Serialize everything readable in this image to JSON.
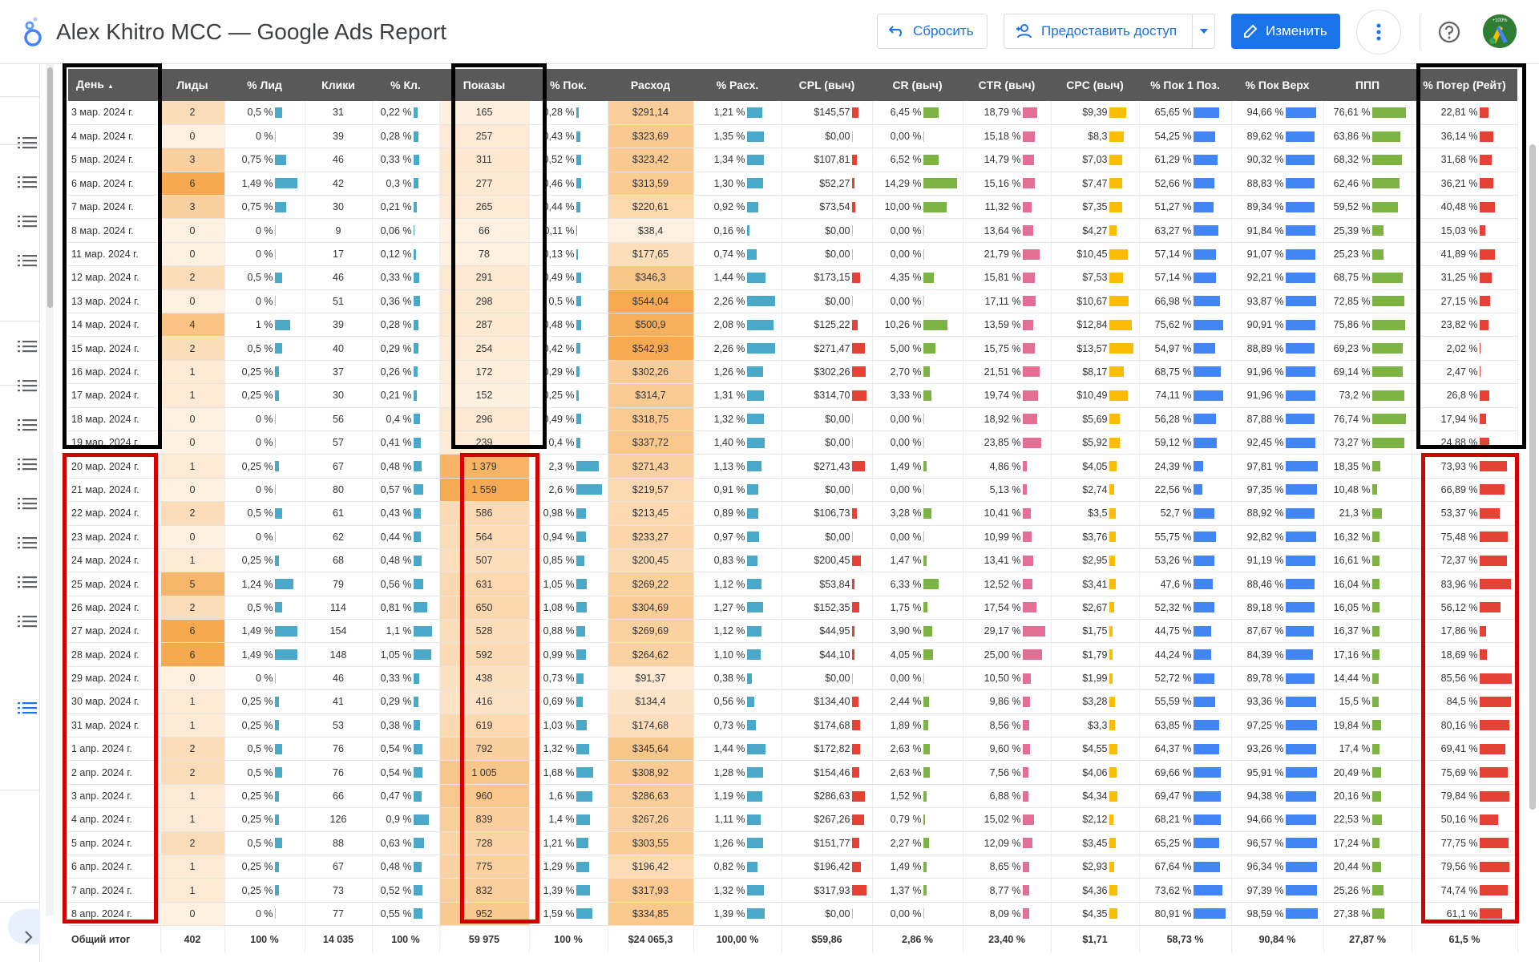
{
  "header": {
    "title": "Alex Khitro MCC — Google Ads Report",
    "reset_label": "Сбросить",
    "share_label": "Предоставить доступ",
    "edit_label": "Изменить",
    "avatar_badge": "+100%"
  },
  "colors": {
    "accent": "#1a73e8",
    "header_bg": "#595959",
    "heat_orange": "#f6a94f",
    "bar_blue": "#4aa8c8",
    "bar_red": "#e34234",
    "bar_green": "#7cb342",
    "bar_pink": "#e36f95",
    "bar_yellow": "#fbbc04",
    "bar_lightblue": "#4285f4",
    "box_black": "#000000",
    "box_red": "#d40000"
  },
  "columns": [
    "День",
    "Лиды",
    "% Лид",
    "Клики",
    "% Кл.",
    "Показы",
    "% Пок.",
    "Расход",
    "% Расх.",
    "CPL (выч)",
    "CR (выч)",
    "CTR (выч)",
    "CPC (выч)",
    "% Пок 1 Поз.",
    "% Пок Верх",
    "ППП",
    "% Потер (Рейт)"
  ],
  "sort_indicator": "▲",
  "rows": [
    [
      "3 мар. 2024 г.",
      "2",
      "0,5 %",
      "31",
      "0,22 %",
      "165",
      "0,28 %",
      "$291,14",
      "1,21 %",
      "$145,57",
      "6,45 %",
      "18,79 %",
      "$9,39",
      "65,65 %",
      "94,66 %",
      "76,61 %",
      "22,81 %"
    ],
    [
      "4 мар. 2024 г.",
      "0",
      "0 %",
      "39",
      "0,28 %",
      "257",
      "0,43 %",
      "$323,69",
      "1,35 %",
      "$0,00",
      "0,00 %",
      "15,18 %",
      "$8,3",
      "54,25 %",
      "89,62 %",
      "63,86 %",
      "36,14 %"
    ],
    [
      "5 мар. 2024 г.",
      "3",
      "0,75 %",
      "46",
      "0,33 %",
      "311",
      "0,52 %",
      "$323,42",
      "1,34 %",
      "$107,81",
      "6,52 %",
      "14,79 %",
      "$7,03",
      "61,29 %",
      "90,32 %",
      "68,32 %",
      "31,68 %"
    ],
    [
      "6 мар. 2024 г.",
      "6",
      "1,49 %",
      "42",
      "0,3 %",
      "277",
      "0,46 %",
      "$313,59",
      "1,30 %",
      "$52,27",
      "14,29 %",
      "15,16 %",
      "$7,47",
      "52,66 %",
      "88,83 %",
      "62,46 %",
      "36,21 %"
    ],
    [
      "7 мар. 2024 г.",
      "3",
      "0,75 %",
      "30",
      "0,21 %",
      "265",
      "0,44 %",
      "$220,61",
      "0,92 %",
      "$73,54",
      "10,00 %",
      "11,32 %",
      "$7,35",
      "51,27 %",
      "89,34 %",
      "59,52 %",
      "40,48 %"
    ],
    [
      "8 мар. 2024 г.",
      "0",
      "0 %",
      "9",
      "0,06 %",
      "66",
      "0,11 %",
      "$38,4",
      "0,16 %",
      "$0,00",
      "0,00 %",
      "13,64 %",
      "$4,27",
      "63,27 %",
      "91,84 %",
      "25,39 %",
      "15,03 %"
    ],
    [
      "11 мар. 2024 г.",
      "0",
      "0 %",
      "17",
      "0,12 %",
      "78",
      "0,13 %",
      "$177,65",
      "0,74 %",
      "$0,00",
      "0,00 %",
      "21,79 %",
      "$10,45",
      "57,14 %",
      "91,07 %",
      "25,23 %",
      "41,89 %"
    ],
    [
      "12 мар. 2024 г.",
      "2",
      "0,5 %",
      "46",
      "0,33 %",
      "291",
      "0,49 %",
      "$346,3",
      "1,44 %",
      "$173,15",
      "4,35 %",
      "15,81 %",
      "$7,53",
      "57,14 %",
      "92,21 %",
      "68,75 %",
      "31,25 %"
    ],
    [
      "13 мар. 2024 г.",
      "0",
      "0 %",
      "51",
      "0,36 %",
      "298",
      "0,5 %",
      "$544,04",
      "2,26 %",
      "$0,00",
      "0,00 %",
      "17,11 %",
      "$10,67",
      "66,98 %",
      "93,87 %",
      "72,85 %",
      "27,15 %"
    ],
    [
      "14 мар. 2024 г.",
      "4",
      "1 %",
      "39",
      "0,28 %",
      "287",
      "0,48 %",
      "$500,9",
      "2,08 %",
      "$125,22",
      "10,26 %",
      "13,59 %",
      "$12,84",
      "75,62 %",
      "90,91 %",
      "75,86 %",
      "23,82 %"
    ],
    [
      "15 мар. 2024 г.",
      "2",
      "0,5 %",
      "40",
      "0,29 %",
      "254",
      "0,42 %",
      "$542,93",
      "2,26 %",
      "$271,47",
      "5,00 %",
      "15,75 %",
      "$13,57",
      "54,97 %",
      "88,89 %",
      "69,23 %",
      "2,02 %"
    ],
    [
      "16 мар. 2024 г.",
      "1",
      "0,25 %",
      "37",
      "0,26 %",
      "172",
      "0,29 %",
      "$302,26",
      "1,26 %",
      "$302,26",
      "2,70 %",
      "21,51 %",
      "$8,17",
      "68,75 %",
      "91,96 %",
      "69,14 %",
      "2,47 %"
    ],
    [
      "17 мар. 2024 г.",
      "1",
      "0,25 %",
      "30",
      "0,21 %",
      "152",
      "0,25 %",
      "$314,7",
      "1,31 %",
      "$314,70",
      "3,33 %",
      "19,74 %",
      "$10,49",
      "74,11 %",
      "91,96 %",
      "73,2 %",
      "26,8 %"
    ],
    [
      "18 мар. 2024 г.",
      "0",
      "0 %",
      "56",
      "0,4 %",
      "296",
      "0,49 %",
      "$318,75",
      "1,32 %",
      "$0,00",
      "0,00 %",
      "18,92 %",
      "$5,69",
      "56,28 %",
      "87,88 %",
      "76,74 %",
      "17,94 %"
    ],
    [
      "19 мар. 2024 г.",
      "0",
      "0 %",
      "57",
      "0,41 %",
      "239",
      "0,4 %",
      "$337,72",
      "1,40 %",
      "$0,00",
      "0,00 %",
      "23,85 %",
      "$5,92",
      "59,12 %",
      "92,45 %",
      "73,27 %",
      "24,88 %"
    ],
    [
      "20 мар. 2024 г.",
      "1",
      "0,25 %",
      "67",
      "0,48 %",
      "1 379",
      "2,3 %",
      "$271,43",
      "1,13 %",
      "$271,43",
      "1,49 %",
      "4,86 %",
      "$4,05",
      "24,39 %",
      "97,81 %",
      "18,35 %",
      "73,93 %"
    ],
    [
      "21 мар. 2024 г.",
      "0",
      "0 %",
      "80",
      "0,57 %",
      "1 559",
      "2,6 %",
      "$219,57",
      "0,91 %",
      "$0,00",
      "0,00 %",
      "5,13 %",
      "$2,74",
      "22,56 %",
      "97,35 %",
      "10,48 %",
      "66,89 %"
    ],
    [
      "22 мар. 2024 г.",
      "2",
      "0,5 %",
      "61",
      "0,43 %",
      "586",
      "0,98 %",
      "$213,45",
      "0,89 %",
      "$106,73",
      "3,28 %",
      "10,41 %",
      "$3,5",
      "52,7 %",
      "88,92 %",
      "21,3 %",
      "53,37 %"
    ],
    [
      "23 мар. 2024 г.",
      "0",
      "0 %",
      "62",
      "0,44 %",
      "564",
      "0,94 %",
      "$233,27",
      "0,97 %",
      "$0,00",
      "0,00 %",
      "10,99 %",
      "$3,76",
      "55,75 %",
      "92,82 %",
      "16,32 %",
      "75,48 %"
    ],
    [
      "24 мар. 2024 г.",
      "1",
      "0,25 %",
      "68",
      "0,48 %",
      "507",
      "0,85 %",
      "$200,45",
      "0,83 %",
      "$200,45",
      "1,47 %",
      "13,41 %",
      "$2,95",
      "53,26 %",
      "91,19 %",
      "16,61 %",
      "72,37 %"
    ],
    [
      "25 мар. 2024 г.",
      "5",
      "1,24 %",
      "79",
      "0,56 %",
      "631",
      "1,05 %",
      "$269,22",
      "1,12 %",
      "$53,84",
      "6,33 %",
      "12,52 %",
      "$3,41",
      "47,6 %",
      "88,46 %",
      "16,04 %",
      "83,96 %"
    ],
    [
      "26 мар. 2024 г.",
      "2",
      "0,5 %",
      "114",
      "0,81 %",
      "650",
      "1,08 %",
      "$304,69",
      "1,27 %",
      "$152,35",
      "1,75 %",
      "17,54 %",
      "$2,67",
      "52,32 %",
      "89,18 %",
      "16,05 %",
      "56,12 %"
    ],
    [
      "27 мар. 2024 г.",
      "6",
      "1,49 %",
      "154",
      "1,1 %",
      "528",
      "0,88 %",
      "$269,69",
      "1,12 %",
      "$44,95",
      "3,90 %",
      "29,17 %",
      "$1,75",
      "44,75 %",
      "87,67 %",
      "16,37 %",
      "17,86 %"
    ],
    [
      "28 мар. 2024 г.",
      "6",
      "1,49 %",
      "148",
      "1,05 %",
      "592",
      "0,99 %",
      "$264,62",
      "1,10 %",
      "$44,10",
      "4,05 %",
      "25,00 %",
      "$1,79",
      "44,24 %",
      "84,39 %",
      "17,16 %",
      "18,69 %"
    ],
    [
      "29 мар. 2024 г.",
      "0",
      "0 %",
      "46",
      "0,33 %",
      "438",
      "0,73 %",
      "$91,37",
      "0,38 %",
      "$0,00",
      "0,00 %",
      "10,50 %",
      "$1,99",
      "52,72 %",
      "89,78 %",
      "14,44 %",
      "85,56 %"
    ],
    [
      "30 мар. 2024 г.",
      "1",
      "0,25 %",
      "41",
      "0,29 %",
      "416",
      "0,69 %",
      "$134,4",
      "0,56 %",
      "$134,40",
      "2,44 %",
      "9,86 %",
      "$3,28",
      "55,59 %",
      "93,36 %",
      "15,5 %",
      "84,5 %"
    ],
    [
      "31 мар. 2024 г.",
      "1",
      "0,25 %",
      "53",
      "0,38 %",
      "619",
      "1,03 %",
      "$174,68",
      "0,73 %",
      "$174,68",
      "1,89 %",
      "8,56 %",
      "$3,3",
      "63,85 %",
      "97,25 %",
      "19,84 %",
      "80,16 %"
    ],
    [
      "1 апр. 2024 г.",
      "2",
      "0,5 %",
      "76",
      "0,54 %",
      "792",
      "1,32 %",
      "$345,64",
      "1,44 %",
      "$172,82",
      "2,63 %",
      "9,60 %",
      "$4,55",
      "64,37 %",
      "93,26 %",
      "17,4 %",
      "69,41 %"
    ],
    [
      "2 апр. 2024 г.",
      "2",
      "0,5 %",
      "76",
      "0,54 %",
      "1 005",
      "1,68 %",
      "$308,92",
      "1,28 %",
      "$154,46",
      "2,63 %",
      "7,56 %",
      "$4,06",
      "69,66 %",
      "95,91 %",
      "20,49 %",
      "75,69 %"
    ],
    [
      "3 апр. 2024 г.",
      "1",
      "0,25 %",
      "66",
      "0,47 %",
      "960",
      "1,6 %",
      "$286,63",
      "1,19 %",
      "$286,63",
      "1,52 %",
      "6,88 %",
      "$4,34",
      "69,47 %",
      "94,38 %",
      "20,16 %",
      "79,84 %"
    ],
    [
      "4 апр. 2024 г.",
      "1",
      "0,25 %",
      "126",
      "0,9 %",
      "839",
      "1,4 %",
      "$267,26",
      "1,11 %",
      "$267,26",
      "0,79 %",
      "15,02 %",
      "$2,12",
      "68,21 %",
      "94,66 %",
      "22,53 %",
      "50,16 %"
    ],
    [
      "5 апр. 2024 г.",
      "2",
      "0,5 %",
      "88",
      "0,63 %",
      "728",
      "1,21 %",
      "$303,55",
      "1,26 %",
      "$151,77",
      "2,27 %",
      "12,09 %",
      "$3,45",
      "65,25 %",
      "96,57 %",
      "17,24 %",
      "77,75 %"
    ],
    [
      "6 апр. 2024 г.",
      "1",
      "0,25 %",
      "67",
      "0,48 %",
      "775",
      "1,29 %",
      "$196,42",
      "0,82 %",
      "$196,42",
      "1,49 %",
      "8,65 %",
      "$2,93",
      "67,64 %",
      "96,34 %",
      "20,44 %",
      "79,56 %"
    ],
    [
      "7 апр. 2024 г.",
      "1",
      "0,25 %",
      "73",
      "0,52 %",
      "832",
      "1,39 %",
      "$317,93",
      "1,32 %",
      "$317,93",
      "1,37 %",
      "8,77 %",
      "$4,36",
      "73,62 %",
      "97,39 %",
      "25,26 %",
      "74,74 %"
    ],
    [
      "8 апр. 2024 г.",
      "0",
      "0 %",
      "77",
      "0,55 %",
      "952",
      "1,59 %",
      "$334,85",
      "1,39 %",
      "$0,00",
      "0,00 %",
      "8,09 %",
      "$4,35",
      "80,91 %",
      "98,59 %",
      "27,38 %",
      "61,1 %"
    ]
  ],
  "totals": [
    "Общий итог",
    "402",
    "100 %",
    "14 035",
    "100 %",
    "59 975",
    "100 %",
    "$24 065,3",
    "100,00 %",
    "$59,86",
    "2,86 %",
    "23,40 %",
    "$1,71",
    "58,73 %",
    "90,84 %",
    "27,87 %",
    "61,5 %"
  ]
}
